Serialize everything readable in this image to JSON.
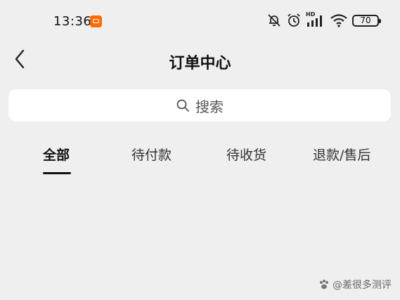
{
  "status_bar": {
    "time": "13:36",
    "network_label": "HD",
    "battery": "70"
  },
  "nav": {
    "title": "订单中心"
  },
  "search": {
    "placeholder": "搜索"
  },
  "tabs": [
    {
      "label": "全部",
      "active": true
    },
    {
      "label": "待付款",
      "active": false
    },
    {
      "label": "待收货",
      "active": false
    },
    {
      "label": "退款/售后",
      "active": false
    }
  ],
  "watermark": {
    "text": "@差很多测评"
  }
}
